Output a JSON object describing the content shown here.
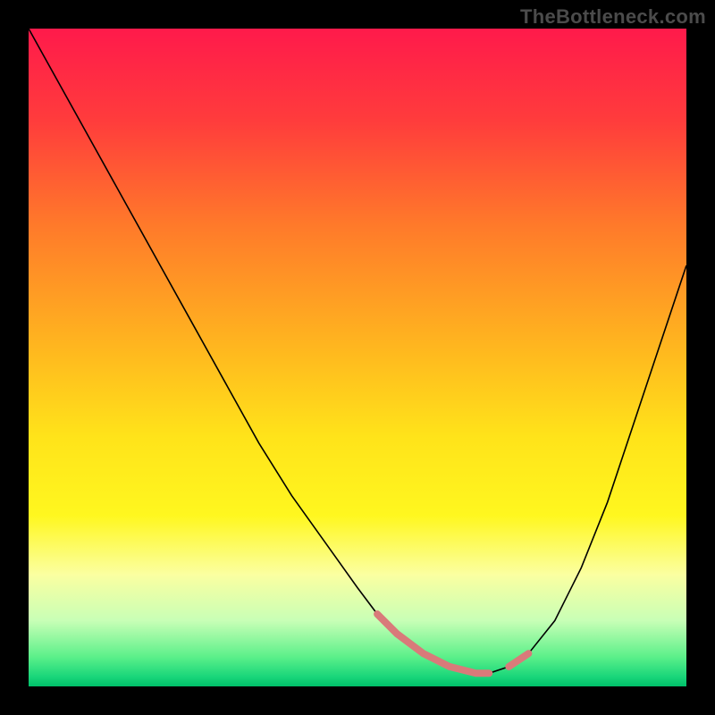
{
  "watermark": "TheBottleneck.com",
  "chart_data": {
    "type": "line",
    "title": "",
    "xlabel": "",
    "ylabel": "",
    "xlim": [
      0,
      100
    ],
    "ylim": [
      0,
      100
    ],
    "background_gradient": {
      "stops": [
        {
          "offset": 0.0,
          "color": "#ff1a4b"
        },
        {
          "offset": 0.14,
          "color": "#ff3c3c"
        },
        {
          "offset": 0.3,
          "color": "#ff7a2a"
        },
        {
          "offset": 0.48,
          "color": "#ffb51f"
        },
        {
          "offset": 0.62,
          "color": "#ffe31a"
        },
        {
          "offset": 0.74,
          "color": "#fff71f"
        },
        {
          "offset": 0.83,
          "color": "#fbffa1"
        },
        {
          "offset": 0.9,
          "color": "#c8ffb6"
        },
        {
          "offset": 0.955,
          "color": "#5cf08a"
        },
        {
          "offset": 0.985,
          "color": "#1ad67a"
        },
        {
          "offset": 1.0,
          "color": "#00c06a"
        }
      ]
    },
    "series": [
      {
        "name": "bottleneck-curve",
        "color": "#000000",
        "width": 1.6,
        "x": [
          0,
          5,
          10,
          15,
          20,
          25,
          30,
          35,
          40,
          45,
          50,
          53,
          56,
          60,
          64,
          68,
          70,
          73,
          76,
          80,
          84,
          88,
          92,
          96,
          100
        ],
        "y": [
          100,
          91,
          82,
          73,
          64,
          55,
          46,
          37,
          29,
          22,
          15,
          11,
          8,
          5,
          3,
          2,
          2,
          3,
          5,
          10,
          18,
          28,
          40,
          52,
          64
        ]
      }
    ],
    "highlight_segments": [
      {
        "name": "floor-left",
        "color": "#d97a7a",
        "width": 8,
        "cap": "round",
        "x": [
          53,
          56,
          60,
          64,
          68,
          70
        ],
        "y": [
          11,
          8,
          5,
          3,
          2,
          2
        ]
      },
      {
        "name": "floor-right",
        "color": "#d97a7a",
        "width": 8,
        "cap": "round",
        "x": [
          73,
          76
        ],
        "y": [
          3,
          5
        ]
      }
    ]
  }
}
